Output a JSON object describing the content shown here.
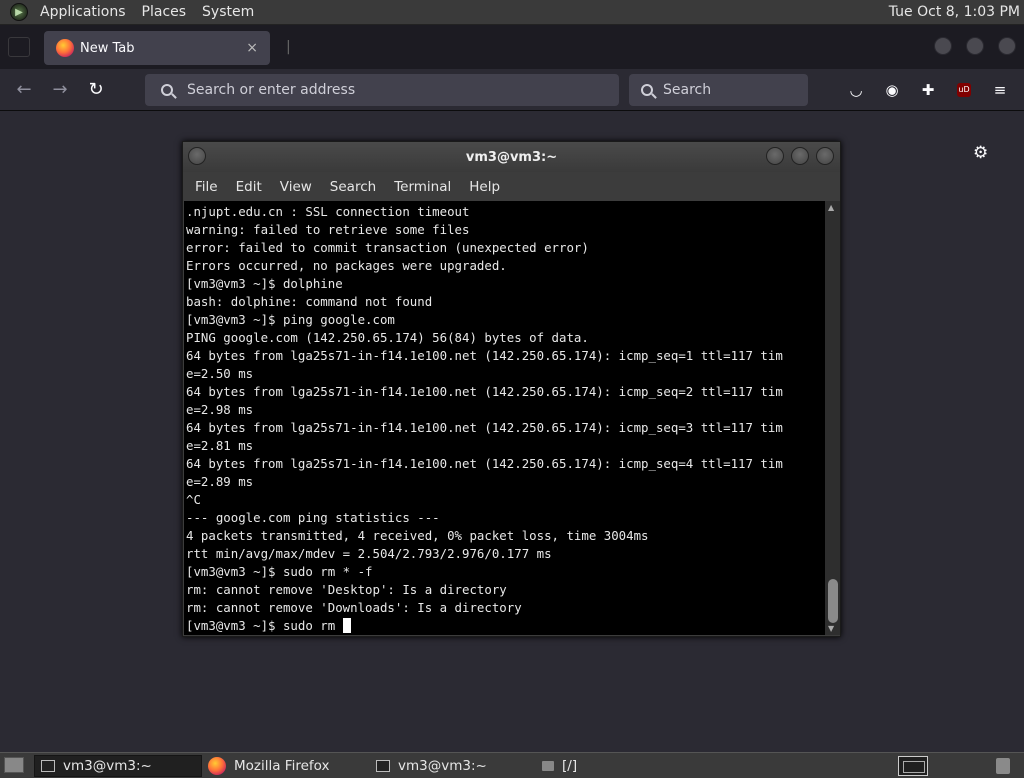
{
  "topbar": {
    "menus": [
      "Applications",
      "Places",
      "System"
    ],
    "clock": "Tue Oct  8,  1:03 PM"
  },
  "browser": {
    "tab_title": "New Tab",
    "tab_close": "×",
    "new_tab_sep": "|",
    "url_placeholder": "Search or enter address",
    "search_placeholder": "Search",
    "ublock_label": "uD"
  },
  "terminal": {
    "title": "vm3@vm3:~",
    "menu": [
      "File",
      "Edit",
      "View",
      "Search",
      "Terminal",
      "Help"
    ],
    "lines": [
      ".njupt.edu.cn : SSL connection timeout",
      "warning: failed to retrieve some files",
      "error: failed to commit transaction (unexpected error)",
      "Errors occurred, no packages were upgraded.",
      "[vm3@vm3 ~]$ dolphine",
      "bash: dolphine: command not found",
      "[vm3@vm3 ~]$ ping google.com",
      "PING google.com (142.250.65.174) 56(84) bytes of data.",
      "64 bytes from lga25s71-in-f14.1e100.net (142.250.65.174): icmp_seq=1 ttl=117 tim",
      "e=2.50 ms",
      "64 bytes from lga25s71-in-f14.1e100.net (142.250.65.174): icmp_seq=2 ttl=117 tim",
      "e=2.98 ms",
      "64 bytes from lga25s71-in-f14.1e100.net (142.250.65.174): icmp_seq=3 ttl=117 tim",
      "e=2.81 ms",
      "64 bytes from lga25s71-in-f14.1e100.net (142.250.65.174): icmp_seq=4 ttl=117 tim",
      "e=2.89 ms",
      "^C",
      "--- google.com ping statistics ---",
      "4 packets transmitted, 4 received, 0% packet loss, time 3004ms",
      "rtt min/avg/max/mdev = 2.504/2.793/2.976/0.177 ms",
      "[vm3@vm3 ~]$ sudo rm * -f",
      "rm: cannot remove 'Desktop': Is a directory",
      "rm: cannot remove 'Downloads': Is a directory"
    ],
    "prompt_line": "[vm3@vm3 ~]$ sudo rm "
  },
  "taskbar": {
    "items": [
      "vm3@vm3:~",
      "Mozilla Firefox",
      "vm3@vm3:~",
      "[/]"
    ]
  }
}
